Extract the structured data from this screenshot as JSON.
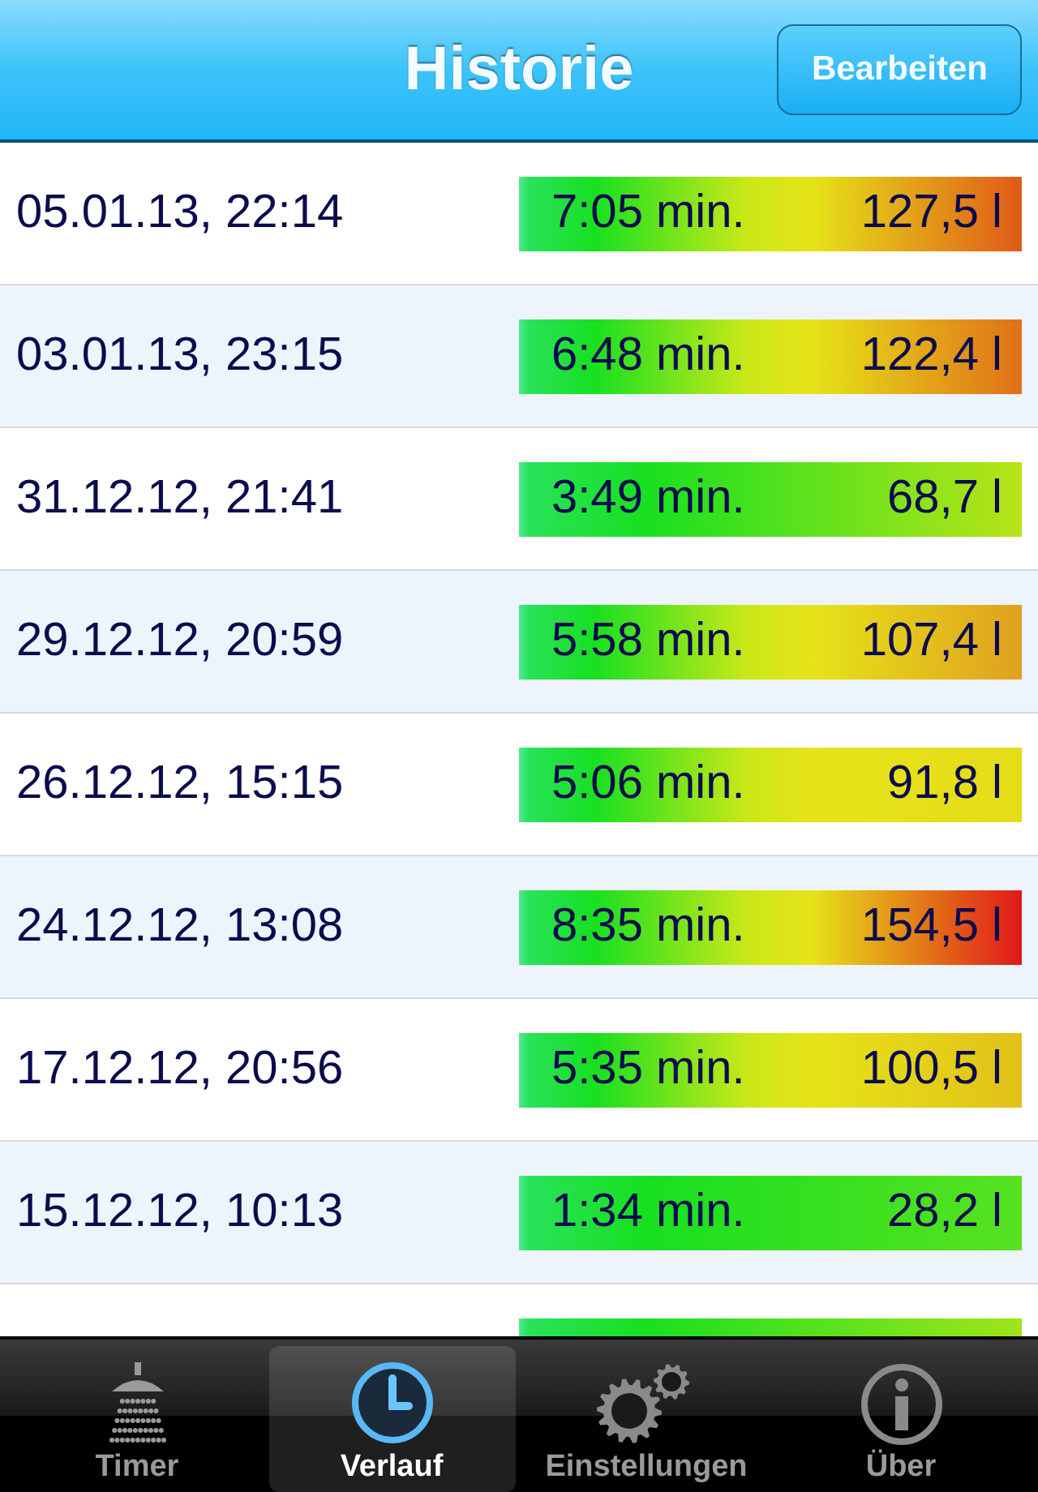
{
  "nav_bar": {
    "title": "Historie",
    "edit_button": "Bearbeiten"
  },
  "rows": [
    {
      "date": "05.01.13, 22:14",
      "duration": "7:05 min.",
      "volume": "127,5 l",
      "color": "#e05a18"
    },
    {
      "date": "03.01.13, 23:15",
      "duration": "6:48 min.",
      "volume": "122,4 l",
      "color": "#e07018"
    },
    {
      "date": "31.12.12, 21:41",
      "duration": "3:49 min.",
      "volume": "68,7 l",
      "color": "#b8e418"
    },
    {
      "date": "29.12.12, 20:59",
      "duration": "5:58 min.",
      "volume": "107,4 l",
      "color": "#e0a020"
    },
    {
      "date": "26.12.12, 15:15",
      "duration": "5:06 min.",
      "volume": "91,8 l",
      "color": "#e4dc18"
    },
    {
      "date": "24.12.12, 13:08",
      "duration": "8:35 min.",
      "volume": "154,5 l",
      "color": "#e01818"
    },
    {
      "date": "17.12.12, 20:56",
      "duration": "5:35 min.",
      "volume": "100,5 l",
      "color": "#e2c018"
    },
    {
      "date": "15.12.12, 10:13",
      "duration": "1:34 min.",
      "volume": "28,2 l",
      "color": "#58e220"
    },
    {
      "color": "#a0e418"
    }
  ],
  "tabs": [
    {
      "kind": "shower",
      "label": "Timer",
      "selected": false
    },
    {
      "kind": "clock",
      "label": "Verlauf",
      "selected": true
    },
    {
      "kind": "gears",
      "label": "Einstellungen",
      "selected": false
    },
    {
      "kind": "info",
      "label": "Über",
      "selected": false
    }
  ]
}
